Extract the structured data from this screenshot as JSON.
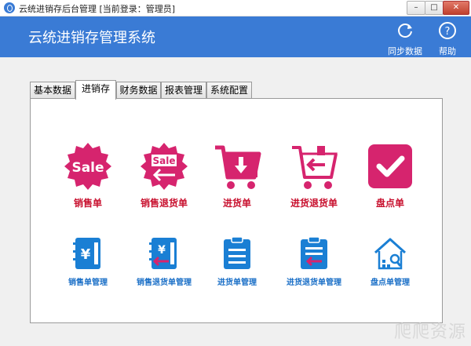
{
  "window": {
    "title": "云统进销存后台管理 [当前登录：管理员]",
    "controls": [
      "minimize-icon",
      "maximize-icon",
      "close-icon"
    ]
  },
  "header": {
    "title": "云统进销存管理系统",
    "sync_label": "同步数据",
    "help_label": "帮助"
  },
  "tabs": [
    {
      "label": "基本数据"
    },
    {
      "label": "进销存",
      "active": true
    },
    {
      "label": "财务数据"
    },
    {
      "label": "报表管理"
    },
    {
      "label": "系统配置"
    }
  ],
  "row1": [
    {
      "label": "销售单",
      "icon": "sale-badge-icon"
    },
    {
      "label": "销售退货单",
      "icon": "sale-return-badge-icon"
    },
    {
      "label": "进货单",
      "icon": "cart-download-icon"
    },
    {
      "label": "进货退货单",
      "icon": "cart-return-icon"
    },
    {
      "label": "盘点单",
      "icon": "checkmark-icon"
    }
  ],
  "row2": [
    {
      "label": "销售单管理",
      "icon": "ledger-yen-icon"
    },
    {
      "label": "销售退货单管理",
      "icon": "ledger-yen-return-icon"
    },
    {
      "label": "进货单管理",
      "icon": "clipboard-list-icon"
    },
    {
      "label": "进货退货单管理",
      "icon": "clipboard-return-icon"
    },
    {
      "label": "盘点单管理",
      "icon": "house-search-icon"
    }
  ],
  "colors": {
    "header_bg": "#3a7bd5",
    "accent_red": "#d6246e",
    "label_red": "#c8102e",
    "accent_blue": "#1a7fd4"
  },
  "watermark": "爬爬资源"
}
